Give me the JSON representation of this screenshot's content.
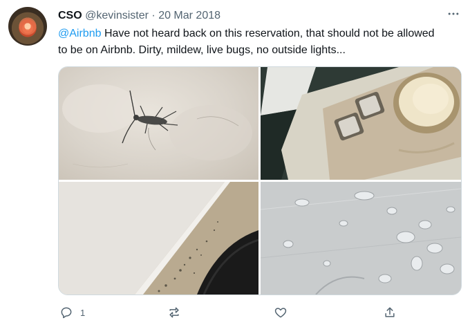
{
  "tweet": {
    "display_name": "CSO",
    "handle": "@kevinsister",
    "separator": "·",
    "date": "20 Mar 2018",
    "mention": "@Airbnb",
    "body": " Have not heard back on this reservation, that should not be allowed to be on Airbnb. Dirty, mildew, live bugs, no outside lights...",
    "more_icon": "more-horizontal-icon",
    "media_count": 4
  },
  "actions": {
    "reply": {
      "icon": "reply-icon",
      "count": "1"
    },
    "retweet": {
      "icon": "retweet-icon"
    },
    "like": {
      "icon": "heart-icon"
    },
    "share": {
      "icon": "share-icon"
    }
  },
  "colors": {
    "accent": "#1d9bf0",
    "secondary_text": "#536471",
    "primary_text": "#0f1419"
  }
}
